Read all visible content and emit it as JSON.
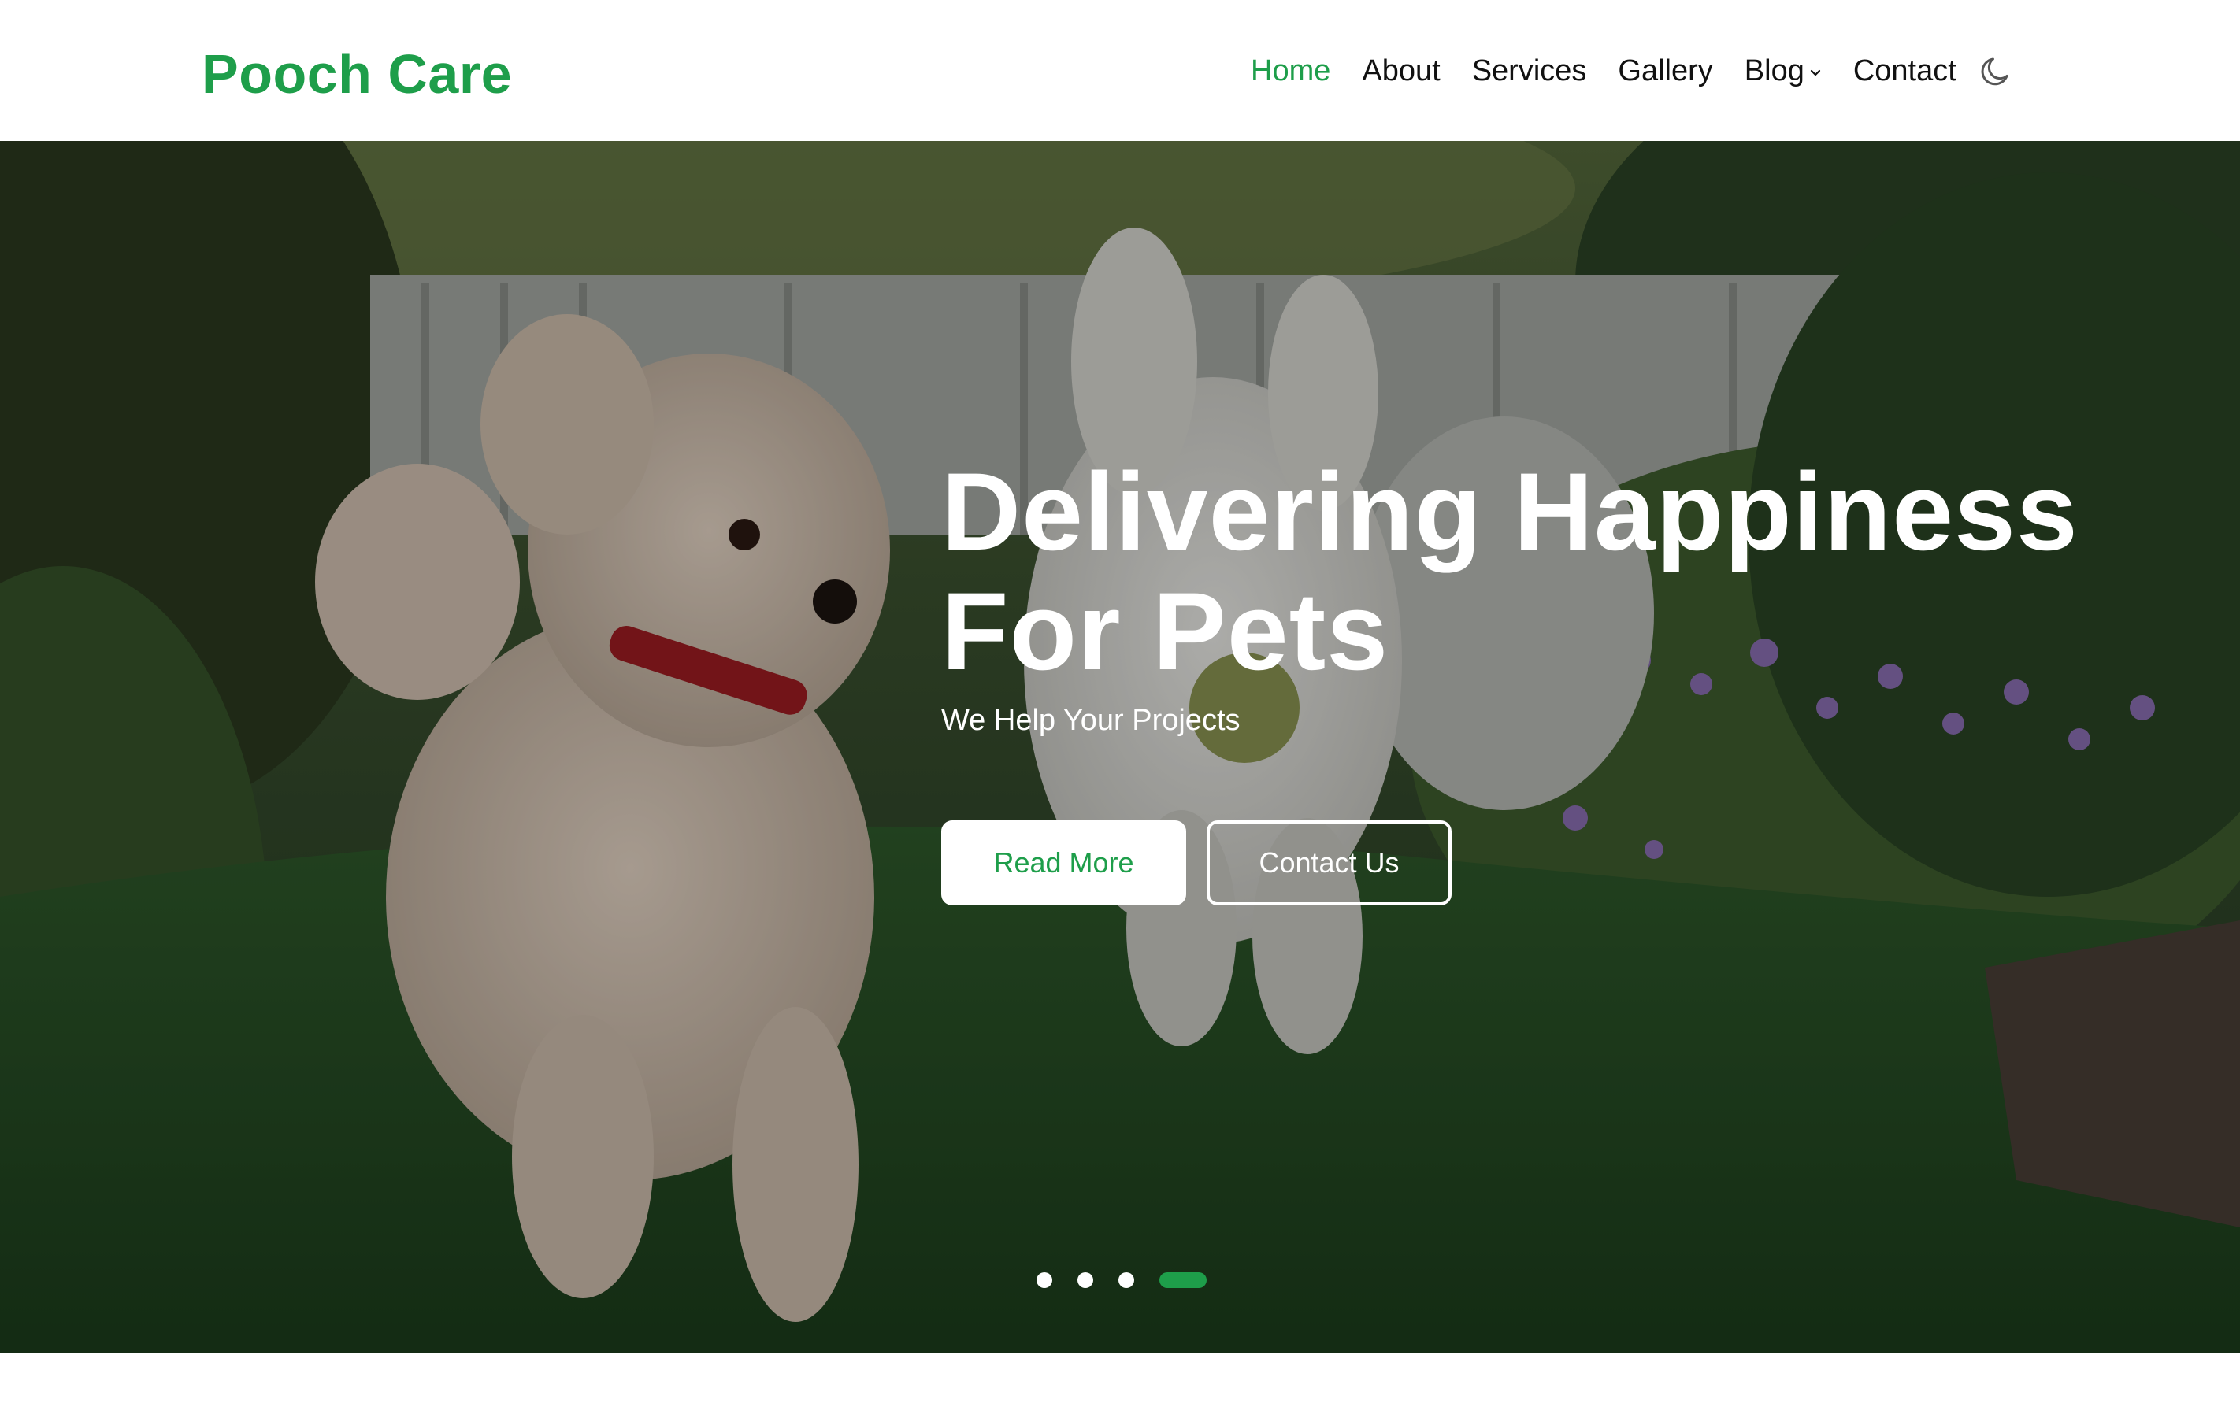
{
  "brand": {
    "name": "Pooch Care",
    "color": "#1e9e4a"
  },
  "nav": {
    "items": [
      {
        "label": "Home",
        "active": true
      },
      {
        "label": "About",
        "active": false
      },
      {
        "label": "Services",
        "active": false
      },
      {
        "label": "Gallery",
        "active": false
      },
      {
        "label": "Blog",
        "active": false,
        "dropdown": true
      },
      {
        "label": "Contact",
        "active": false
      }
    ],
    "theme_toggle_icon": "moon-icon"
  },
  "hero": {
    "title_line1": "Delivering Happiness",
    "title_line2": "For Pets",
    "subtitle": "We Help Your Projects",
    "primary_button": "Read More",
    "secondary_button": "Contact Us",
    "slides": {
      "count": 4,
      "active_index": 3
    }
  }
}
